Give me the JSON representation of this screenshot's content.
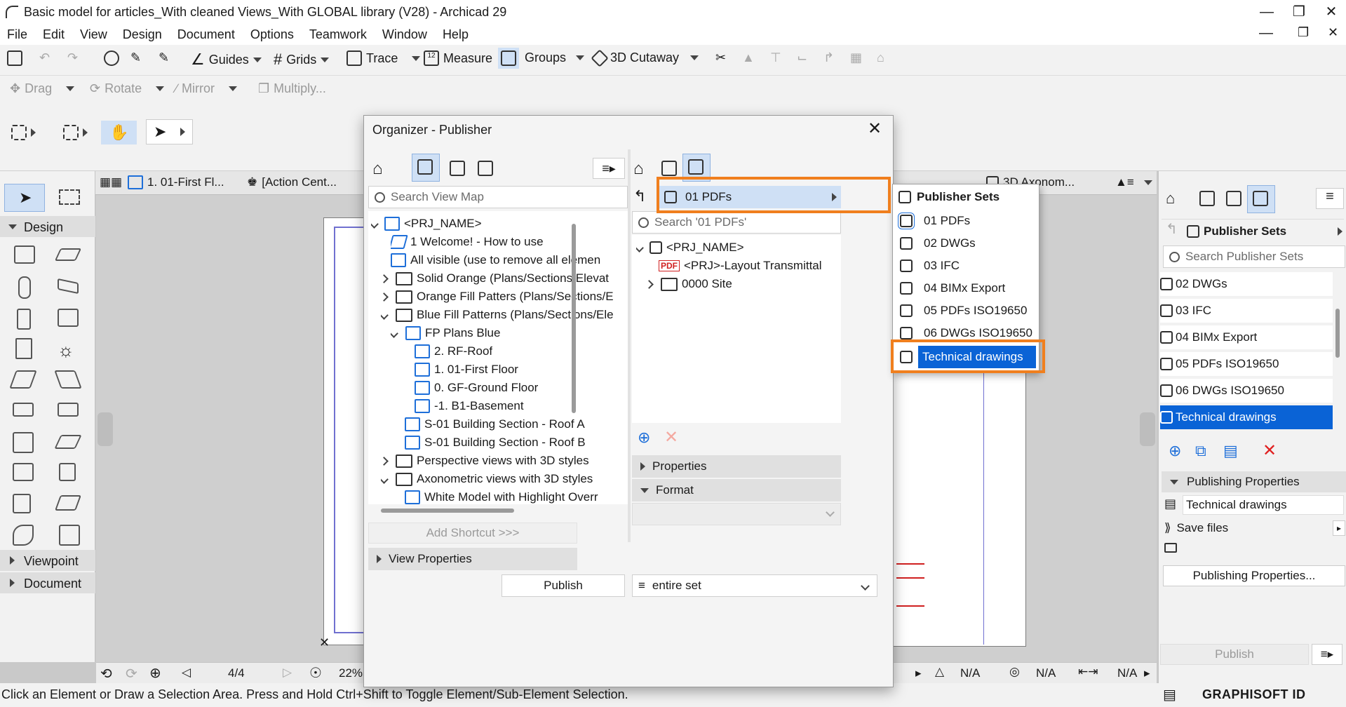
{
  "window": {
    "title": "Basic model for articles_With cleaned Views_With GLOBAL library (V28) - Archicad 29"
  },
  "menu": [
    "File",
    "Edit",
    "View",
    "Design",
    "Document",
    "Options",
    "Teamwork",
    "Window",
    "Help"
  ],
  "toolbar1": {
    "guides": "Guides",
    "grids": "Grids",
    "trace": "Trace",
    "measure": "Measure",
    "groups": "Groups",
    "cutaway": "3D Cutaway"
  },
  "toolbar2": {
    "drag": "Drag",
    "rotate": "Rotate",
    "mirror": "Mirror",
    "multiply": "Multiply..."
  },
  "tabs": [
    {
      "label": "1. 01-First Fl..."
    },
    {
      "label": "[Action Cent..."
    },
    {
      "label": "3D Axonom..."
    }
  ],
  "toolbox": {
    "design": "Design",
    "viewpoint": "Viewpoint",
    "document": "Document"
  },
  "organizer": {
    "title": "Organizer - Publisher",
    "left": {
      "search_placeholder": "Search View Map",
      "tree": [
        {
          "label": "<PRJ_NAME>"
        },
        {
          "label": "1 Welcome! - How to use"
        },
        {
          "label": "All visible (use to remove all elemen"
        },
        {
          "label": "Solid Orange (Plans/Sections/Elevat"
        },
        {
          "label": "Orange Fill Patters (Plans/Sections/E"
        },
        {
          "label": "Blue Fill Patterns (Plans/Sections/Ele"
        },
        {
          "label": "FP Plans Blue"
        },
        {
          "label": "2. RF-Roof"
        },
        {
          "label": "1. 01-First Floor"
        },
        {
          "label": "0. GF-Ground Floor"
        },
        {
          "label": "-1. B1-Basement"
        },
        {
          "label": "S-01 Building Section - Roof A"
        },
        {
          "label": "S-01 Building Section - Roof B"
        },
        {
          "label": "Perspective views with 3D styles"
        },
        {
          "label": "Axonometric views with 3D styles"
        },
        {
          "label": "White Model with Highlight Overr"
        }
      ],
      "add_shortcut": "Add Shortcut >>>",
      "view_properties": "View Properties"
    },
    "right": {
      "set_selector": "01 PDFs",
      "search_placeholder": "Search '01 PDFs'",
      "tree": [
        {
          "label": "<PRJ_NAME>"
        },
        {
          "label": "<PRJ>-Layout Transmittal"
        },
        {
          "label": "0000 Site"
        }
      ],
      "properties": "Properties",
      "format": "Format",
      "publish": "Publish",
      "scope": "entire set"
    }
  },
  "submenu": {
    "header": "Publisher Sets",
    "items": [
      {
        "label": "01 PDFs"
      },
      {
        "label": "02 DWGs"
      },
      {
        "label": "03 IFC"
      },
      {
        "label": "04 BIMx Export"
      },
      {
        "label": "05 PDFs ISO19650"
      },
      {
        "label": "06 DWGs ISO19650"
      },
      {
        "label": "Technical drawings"
      }
    ]
  },
  "right_panel": {
    "header": "Publisher Sets",
    "search_placeholder": "Search Publisher Sets",
    "items": [
      {
        "label": "02 DWGs"
      },
      {
        "label": "03 IFC"
      },
      {
        "label": "04 BIMx Export"
      },
      {
        "label": "05 PDFs ISO19650"
      },
      {
        "label": "06 DWGs ISO19650"
      },
      {
        "label": "Technical drawings"
      }
    ],
    "publishing_properties_header": "Publishing Properties",
    "set_name": "Technical drawings",
    "save_files": "Save files",
    "publishing_properties_button": "Publishing Properties...",
    "publish": "Publish"
  },
  "navbar": {
    "page": "4/4",
    "zoom": "22%",
    "na1": "N/A",
    "na2": "N/A",
    "na3": "N/A"
  },
  "status": {
    "hint": "Click an Element or Draw a Selection Area. Press and Hold Ctrl+Shift to Toggle Element/Sub-Element Selection.",
    "brand": "GRAPHISOFT ID"
  },
  "colors": {
    "selection_blue": "#0a63d6",
    "highlight_orange": "#f07f1e"
  }
}
